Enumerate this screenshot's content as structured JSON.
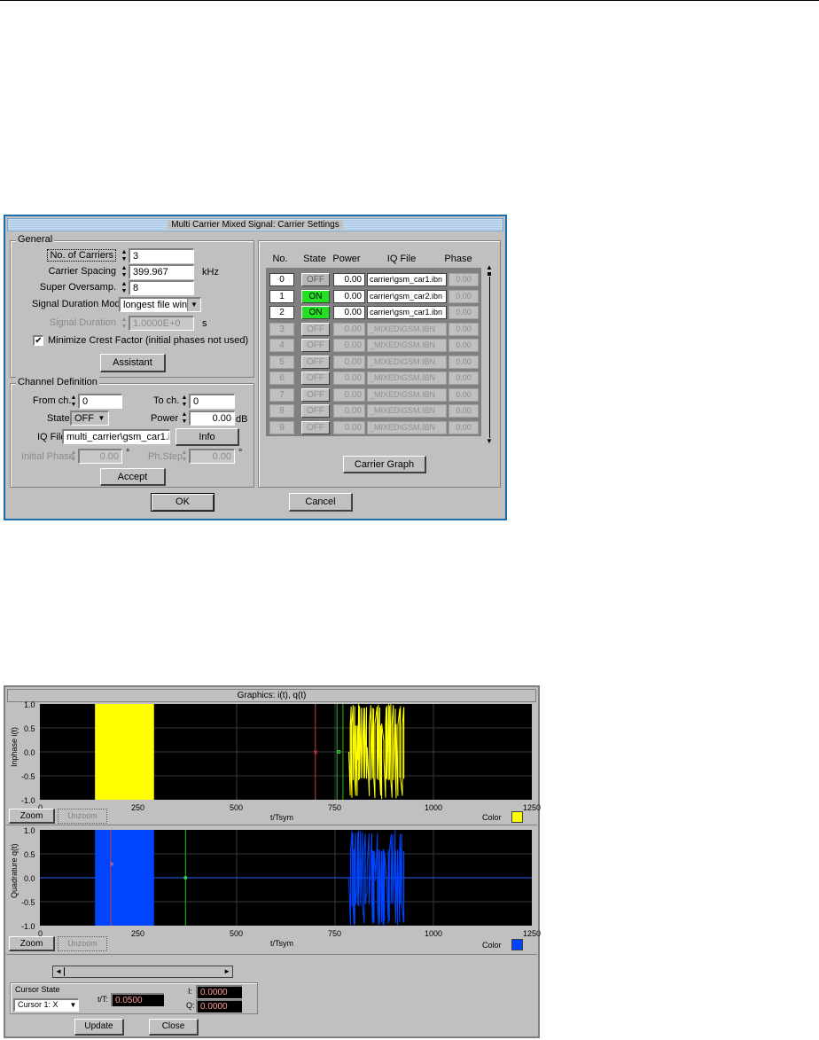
{
  "carrier_dialog": {
    "title": "Multi Carrier Mixed Signal: Carrier Settings",
    "general": {
      "group_label": "General",
      "num_carriers_label": "No. of Carriers",
      "num_carriers_value": "3",
      "carrier_spacing_label": "Carrier Spacing",
      "carrier_spacing_value": "399.967",
      "carrier_spacing_unit": "kHz",
      "super_oversamp_label": "Super Oversamp.",
      "super_oversamp_value": "8",
      "signal_duration_mode_label": "Signal Duration Mode",
      "signal_duration_mode_value": "longest file wins",
      "signal_duration_label": "Signal Duration",
      "signal_duration_value": "1.0000E+0",
      "signal_duration_unit": "s",
      "minimize_crest_label": "Minimize Crest Factor (initial phases not used)",
      "minimize_crest_checked": "✔",
      "assistant_label": "Assistant"
    },
    "channel_def": {
      "group_label": "Channel Definition",
      "from_ch_label": "From ch.",
      "from_ch_value": "0",
      "to_ch_label": "To ch.",
      "to_ch_value": "0",
      "state_label": "State",
      "state_value": "OFF",
      "power_label": "Power",
      "power_value": "0.00",
      "power_unit": "dB",
      "iq_file_label": "IQ File",
      "iq_file_value": "multi_carrier\\gsm_car1.ibn",
      "info_label": "Info",
      "initial_phase_label": "Initial Phase",
      "initial_phase_value": "0.00",
      "initial_phase_unit": "°",
      "ph_step_label": "Ph.Step",
      "ph_step_value": "0.00",
      "ph_step_unit": "°",
      "accept_label": "Accept"
    },
    "table": {
      "headers": [
        "No.",
        "State",
        "Power",
        "IQ File",
        "Phase"
      ],
      "rows": [
        {
          "no": "0",
          "state": "OFF",
          "power": "0.00",
          "iq": "carrier\\gsm_car1.ibn",
          "phase": "0.00"
        },
        {
          "no": "1",
          "state": "ON",
          "power": "0.00",
          "iq": "carrier\\gsm_car2.ibn",
          "phase": "0.00"
        },
        {
          "no": "2",
          "state": "ON",
          "power": "0.00",
          "iq": "carrier\\gsm_car1.ibn",
          "phase": "0.00"
        },
        {
          "no": "3",
          "state": "OFF",
          "power": "0.00",
          "iq": "_MIXED\\GSM.IBN",
          "phase": "0.00"
        },
        {
          "no": "4",
          "state": "OFF",
          "power": "0.00",
          "iq": "_MIXED\\GSM.IBN",
          "phase": "0.00"
        },
        {
          "no": "5",
          "state": "OFF",
          "power": "0.00",
          "iq": "_MIXED\\GSM.IBN",
          "phase": "0.00"
        },
        {
          "no": "6",
          "state": "OFF",
          "power": "0.00",
          "iq": "_MIXED\\GSM.IBN",
          "phase": "0.00"
        },
        {
          "no": "7",
          "state": "OFF",
          "power": "0.00",
          "iq": "_MIXED\\GSM.IBN",
          "phase": "0.00"
        },
        {
          "no": "8",
          "state": "OFF",
          "power": "0.00",
          "iq": "_MIXED\\GSM.IBN",
          "phase": "0.00"
        },
        {
          "no": "9",
          "state": "OFF",
          "power": "0.00",
          "iq": "_MIXED\\GSM.IBN",
          "phase": "0.00"
        }
      ],
      "carrier_graph_label": "Carrier Graph"
    },
    "ok_label": "OK",
    "cancel_label": "Cancel"
  },
  "graphics_window": {
    "title": "Graphics: i(t), q(t)",
    "inphase_plot": {
      "ylabel": "Inphase i(t)",
      "xlabel": "t/Tsym",
      "color_label": "Color",
      "color": "#ffff00",
      "zoom_label": "Zoom",
      "unzoom_label": "Unzoom",
      "yticks": [
        "1.0",
        "0.5",
        "0.0",
        "-0.5",
        "-1.0"
      ],
      "xticks": [
        "0",
        "250",
        "500",
        "750",
        "1000",
        "1250"
      ]
    },
    "quadrature_plot": {
      "ylabel": "Quadrature q(t)",
      "xlabel": "t/Tsym",
      "color_label": "Color",
      "color": "#0044ff",
      "zoom_label": "Zoom",
      "unzoom_label": "Unzoom",
      "yticks": [
        "1.0",
        "0.5",
        "0.0",
        "-0.5",
        "-1.0"
      ],
      "xticks": [
        "0",
        "250",
        "500",
        "750",
        "1000",
        "1250"
      ]
    },
    "cursor": {
      "group_label": "Cursor State",
      "select_value": "Cursor 1: X",
      "t_label": "t/T:",
      "t_value": "0.0500",
      "i_label": "I:",
      "i_value": "0.0000",
      "q_label": "Q:",
      "q_value": "0.0000"
    },
    "update_label": "Update",
    "close_label": "Close"
  }
}
